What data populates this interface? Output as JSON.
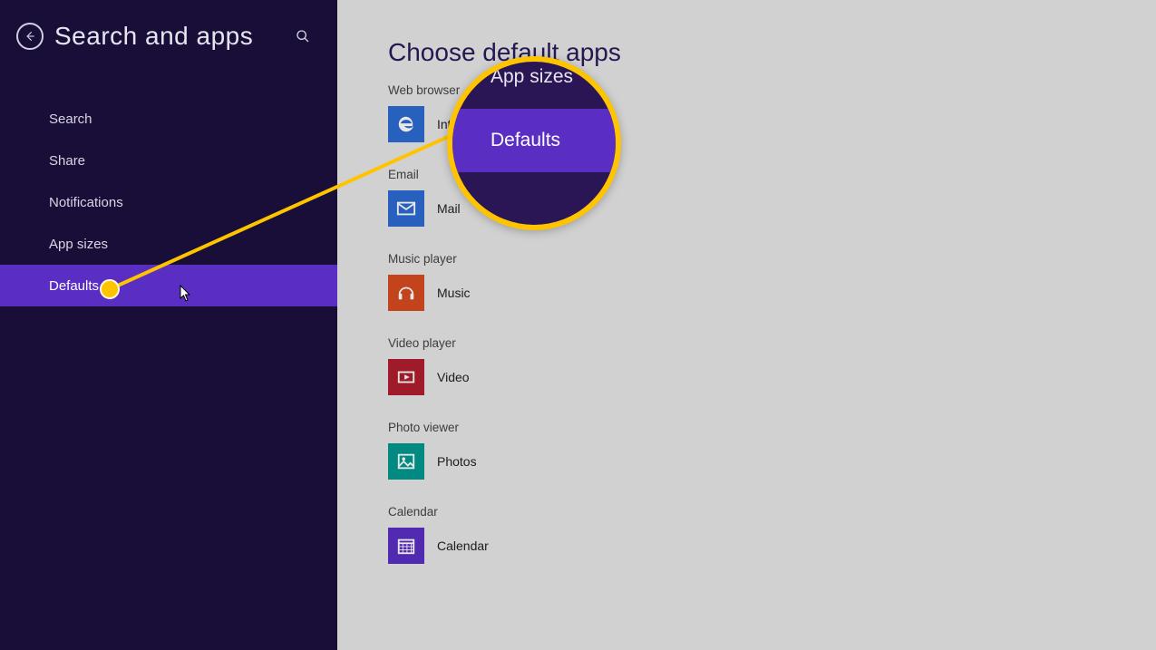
{
  "sidebar": {
    "title": "Search and apps",
    "items": [
      {
        "label": "Search",
        "selected": false
      },
      {
        "label": "Share",
        "selected": false
      },
      {
        "label": "Notifications",
        "selected": false
      },
      {
        "label": "App sizes",
        "selected": false
      },
      {
        "label": "Defaults",
        "selected": true
      }
    ]
  },
  "page": {
    "title": "Choose default apps",
    "sections": [
      {
        "label": "Web browser",
        "app": "Internet Explorer",
        "icon": "ie",
        "color": "#2b6bd0"
      },
      {
        "label": "Email",
        "app": "Mail",
        "icon": "mail",
        "color": "#2b6bd0"
      },
      {
        "label": "Music player",
        "app": "Music",
        "icon": "music",
        "color": "#d64a1f"
      },
      {
        "label": "Video player",
        "app": "Video",
        "icon": "video",
        "color": "#b01e2e"
      },
      {
        "label": "Photo viewer",
        "app": "Photos",
        "icon": "photos",
        "color": "#00988f"
      },
      {
        "label": "Calendar",
        "app": "Calendar",
        "icon": "calendar",
        "color": "#5b2ec3"
      }
    ]
  },
  "callout": {
    "lens_items": [
      {
        "label": "App sizes",
        "selected": false
      },
      {
        "label": "Defaults",
        "selected": true
      }
    ],
    "highlight_color": "#ffc400"
  }
}
